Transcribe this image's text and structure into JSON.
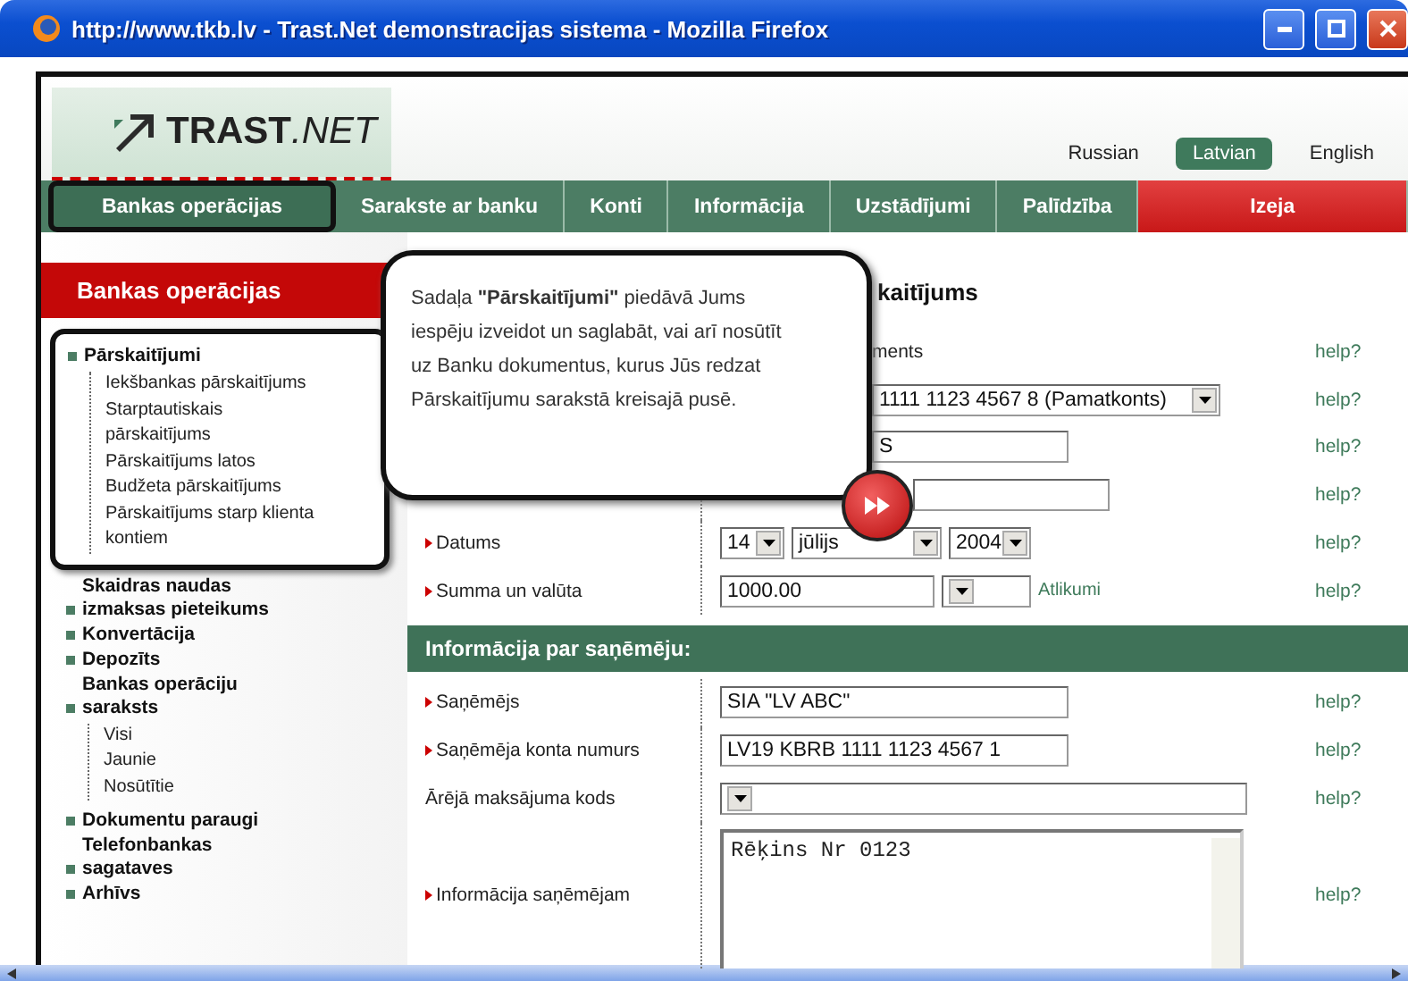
{
  "window": {
    "title": "http://www.tkb.lv - Trast.Net demonstracijas sistema - Mozilla Firefox"
  },
  "logo": {
    "bold": "TRAST",
    "light": ".NET"
  },
  "languages": [
    {
      "label": "Russian",
      "selected": false
    },
    {
      "label": "Latvian",
      "selected": true
    },
    {
      "label": "English",
      "selected": false
    }
  ],
  "nav": [
    {
      "label": "Bankas operācijas",
      "selected": true,
      "kind": "normal"
    },
    {
      "label": "Sarakste ar banku",
      "selected": false,
      "kind": "normal"
    },
    {
      "label": "Konti",
      "selected": false,
      "kind": "normal"
    },
    {
      "label": "Informācija",
      "selected": false,
      "kind": "normal"
    },
    {
      "label": "Uzstādījumi",
      "selected": false,
      "kind": "normal"
    },
    {
      "label": "Palīdzība",
      "selected": false,
      "kind": "normal"
    },
    {
      "label": "Izeja",
      "selected": false,
      "kind": "exit"
    }
  ],
  "sidebar": {
    "title": "Bankas operācijas",
    "items": [
      {
        "label": "Pārskaitījumi",
        "highlighted": true,
        "children": [
          {
            "label": "Iekšbankas pārskaitījums"
          },
          {
            "label": "Starptautiskais pārskaitījums"
          },
          {
            "label": "Pārskaitījums latos"
          },
          {
            "label": "Budžeta pārskaitījums"
          },
          {
            "label": "Pārskaitījums starp klienta kontiem"
          }
        ]
      },
      {
        "label": "Skaidras naudas izmaksas pieteikums",
        "highlighted": false
      },
      {
        "label": "Konvertācija",
        "highlighted": false
      },
      {
        "label": "Depozīts",
        "highlighted": false
      },
      {
        "label": "Bankas operāciju saraksts",
        "highlighted": false,
        "children": [
          {
            "label": "Visi"
          },
          {
            "label": "Jaunie"
          },
          {
            "label": "Nosūtītie"
          }
        ]
      },
      {
        "label": "Dokumentu paraugi",
        "highlighted": false
      },
      {
        "label": "Telefonbankas sagataves",
        "highlighted": false
      },
      {
        "label": "Arhīvs",
        "highlighted": false
      }
    ]
  },
  "tooltip": {
    "text": "Sadaļa **\"Pārskaitījumi\"** piedāvā Jums iespēju izveidot un saglabāt, vai arī nosūtīt uz Banku dokumentus, kurus Jūs redzat Pārskaitījumu sarakstā kreisajā pusē."
  },
  "form": {
    "title": "kaitījums",
    "covered_rows": [
      {
        "kind": "label",
        "label": "ments",
        "help": "help?"
      },
      {
        "kind": "select",
        "value": "1111 1123 4567 8 (Pamatkonts)",
        "help": "help?"
      },
      {
        "kind": "text",
        "value": "S",
        "help": "help?"
      },
      {
        "kind": "text",
        "help": "help?"
      }
    ],
    "rows": [
      {
        "kind": "date",
        "label": "Datums",
        "required": true,
        "day": "14",
        "month": "jūlijs",
        "year": "2004",
        "help": "help?"
      },
      {
        "kind": "amount",
        "label": "Summa un valūta",
        "required": true,
        "value": "1000.00",
        "link": "Atlikumi",
        "help": "help?"
      }
    ],
    "section": "Informācija par saņēmēju:",
    "recipient_rows": [
      {
        "kind": "text",
        "label": "Saņēmējs",
        "required": true,
        "value": "SIA \"LV ABC\"",
        "help": "help?"
      },
      {
        "kind": "text",
        "label": "Saņēmēja konta numurs",
        "required": true,
        "value": "LV19 KBRB 1111 1123 4567 1",
        "help": "help?"
      },
      {
        "kind": "select",
        "label": "Ārējā maksājuma kods",
        "required": false,
        "help": "help?"
      },
      {
        "kind": "textarea",
        "label": "Informācija saņēmējam",
        "required": true,
        "value": "Rēķins Nr 0123",
        "help": "help?"
      }
    ]
  }
}
